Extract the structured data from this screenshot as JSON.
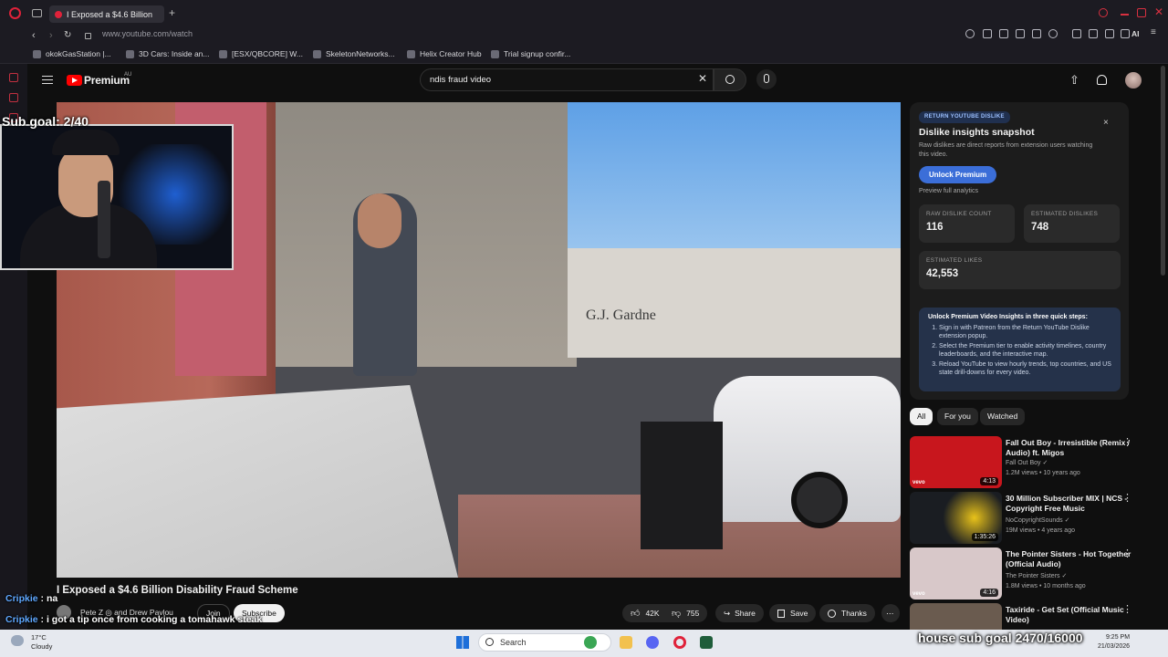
{
  "browser": {
    "tab_title": "I Exposed a $4.6 Billion",
    "url": "www.youtube.com/watch",
    "bookmarks": [
      "okokGasStation |...",
      "3D Cars: Inside an...",
      "[ESX/QBCORE] W...",
      "SkeletonNetworks...",
      "Helix Creator Hub",
      "Trial signup confir..."
    ],
    "ai_label": "AI"
  },
  "header": {
    "brand": "Premium",
    "region": "AU",
    "search_value": "ndis fraud video"
  },
  "stream": {
    "sub_goal": "Sub goal: 2/40",
    "house_goal": "house sub goal 2470/16000",
    "chat": [
      {
        "name": "Cripkie",
        "text": ": na"
      },
      {
        "name": "Cripkie",
        "text": ": i got a tip once from cooking a tomahawk steak"
      }
    ]
  },
  "video": {
    "sign_text": "G.J. Gardne",
    "title": "I Exposed a $4.6 Billion Disability Fraud Scheme",
    "channel": "Pete Z ◎ and Drew Pavlou",
    "join": "Join",
    "subscribe": "Subscribe",
    "likes": "42K",
    "dislikes": "755",
    "share": "Share",
    "save": "Save",
    "thanks": "Thanks"
  },
  "panel": {
    "badge": "RETURN YOUTUBE DISLIKE",
    "title": "Dislike insights snapshot",
    "subtitle": "Raw dislikes are direct reports from extension users watching this video.",
    "close": "×",
    "unlock": "Unlock Premium",
    "preview": "Preview full analytics",
    "stats": [
      {
        "label": "RAW DISLIKE COUNT",
        "value": "116"
      },
      {
        "label": "ESTIMATED DISLIKES",
        "value": "748"
      },
      {
        "label": "ESTIMATED LIKES",
        "value": "42,553"
      }
    ],
    "steps_title": "Unlock Premium Video Insights in three quick steps:",
    "steps": [
      "Sign in with Patreon from the Return YouTube Dislike extension popup.",
      "Select the Premium tier to enable activity timelines, country leaderboards, and the interactive map.",
      "Reload YouTube to view hourly trends, top countries, and US state drill-downs for every video."
    ]
  },
  "chips": [
    "All",
    "For you",
    "Watched"
  ],
  "recommendations": [
    {
      "title": "Fall Out Boy - Irresistible (Remix / Audio) ft. Migos",
      "channel": "Fall Out Boy ✓",
      "meta": "1.2M views • 10 years ago",
      "duration": "4:13",
      "vevo": "vevo",
      "color": "#c8161d"
    },
    {
      "title": "30 Million Subscriber MIX | NCS - Copyright Free Music",
      "channel": "NoCopyrightSounds ✓",
      "meta": "19M views • 4 years ago",
      "duration": "1:35:26",
      "vevo": "",
      "color": "#1a1d22"
    },
    {
      "title": "The Pointer Sisters - Hot Together (Official Audio)",
      "channel": "The Pointer Sisters ✓",
      "meta": "1.8M views • 10 months ago",
      "duration": "4:16",
      "vevo": "vevo",
      "color": "#d8c8c9"
    },
    {
      "title": "Taxiride - Get Set (Official Music Video)",
      "channel": "",
      "meta": "",
      "duration": "",
      "vevo": "",
      "color": "#6a5b4f"
    }
  ],
  "taskbar": {
    "temp": "17°C",
    "weather": "Cloudy",
    "search": "Search",
    "time": "9:25 PM",
    "date": "21/03/2026"
  }
}
